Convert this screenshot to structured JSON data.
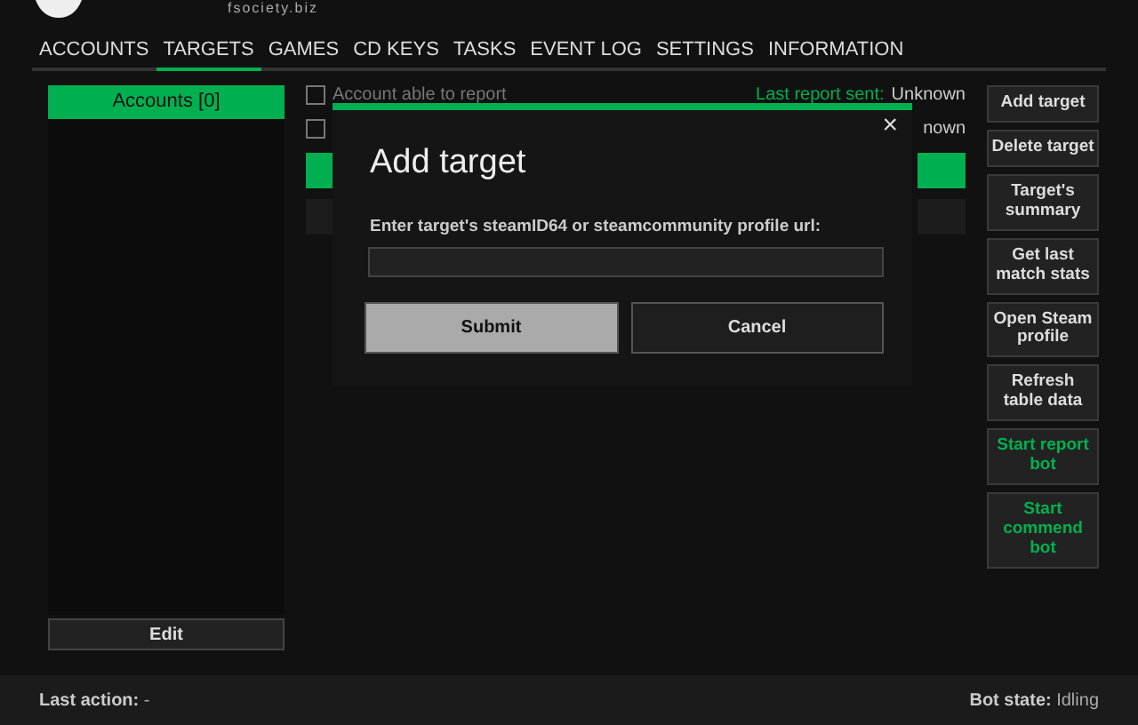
{
  "brand": {
    "site": "fsociety.biz"
  },
  "tabs": [
    {
      "label": "ACCOUNTS",
      "selected": false
    },
    {
      "label": "TARGETS",
      "selected": true
    },
    {
      "label": "GAMES",
      "selected": false
    },
    {
      "label": "CD KEYS",
      "selected": false
    },
    {
      "label": "TASKS",
      "selected": false
    },
    {
      "label": "EVENT LOG",
      "selected": false
    },
    {
      "label": "SETTINGS",
      "selected": false
    },
    {
      "label": "INFORMATION",
      "selected": false
    }
  ],
  "accounts_panel": {
    "header": "Accounts [0]",
    "edit_button": "Edit"
  },
  "options": [
    {
      "label": "Account able to report",
      "checked": false,
      "status_label": "Last report sent:",
      "status_value": "Unknown"
    },
    {
      "checked": false,
      "status_value": "nown"
    }
  ],
  "table_rows": [
    {
      "selected": true
    },
    {
      "selected": false
    }
  ],
  "actions": [
    {
      "label": "Add target",
      "kind": "plain"
    },
    {
      "label": "Delete target",
      "kind": "plain"
    },
    {
      "label": "Target's summary",
      "kind": "plain"
    },
    {
      "label": "Get last match stats",
      "kind": "plain"
    },
    {
      "label": "Open Steam profile",
      "kind": "plain"
    },
    {
      "label": "Refresh table data",
      "kind": "plain"
    },
    {
      "label": "Start report bot",
      "kind": "bot"
    },
    {
      "label": "Start commend bot",
      "kind": "bot"
    }
  ],
  "dialog": {
    "title": "Add target",
    "close": "×",
    "prompt": "Enter target's steamID64 or steamcommunity profile url:",
    "buttons": [
      {
        "label": "Submit",
        "kind": "primary"
      },
      {
        "label": "Cancel",
        "kind": "secondary"
      }
    ]
  },
  "status_bar": {
    "last_action_label": "Last action:",
    "last_action_value": "-",
    "bot_state_label": "Bot state:",
    "bot_state_value": "Idling"
  }
}
